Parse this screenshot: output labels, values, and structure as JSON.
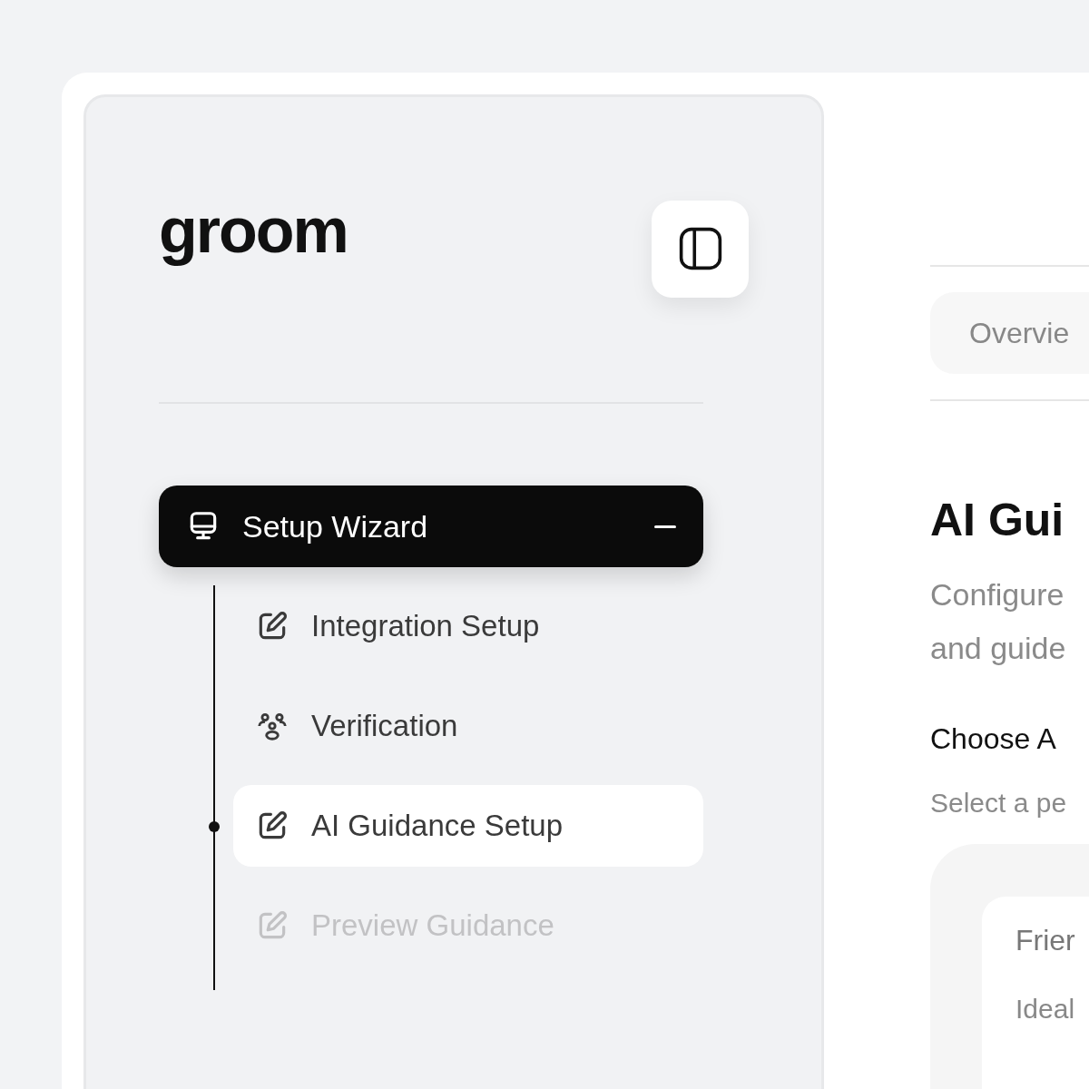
{
  "logo": "groom",
  "nav": {
    "parent": {
      "label": "Setup Wizard",
      "expanded": true
    },
    "children": [
      {
        "label": "Integration Setup",
        "kind": "edit",
        "selected": false,
        "disabled": false
      },
      {
        "label": "Verification",
        "kind": "people",
        "selected": false,
        "disabled": false
      },
      {
        "label": "AI Guidance Setup",
        "kind": "edit",
        "selected": true,
        "disabled": false
      },
      {
        "label": "Preview Guidance",
        "kind": "edit",
        "selected": false,
        "disabled": true
      }
    ]
  },
  "main": {
    "tab": "Overvie",
    "title": "AI Gui",
    "description": [
      "Configure",
      "and guide"
    ],
    "section_title": "Choose A",
    "section_hint": "Select a pe",
    "card": {
      "title": "Frier",
      "text": "Ideal"
    }
  }
}
